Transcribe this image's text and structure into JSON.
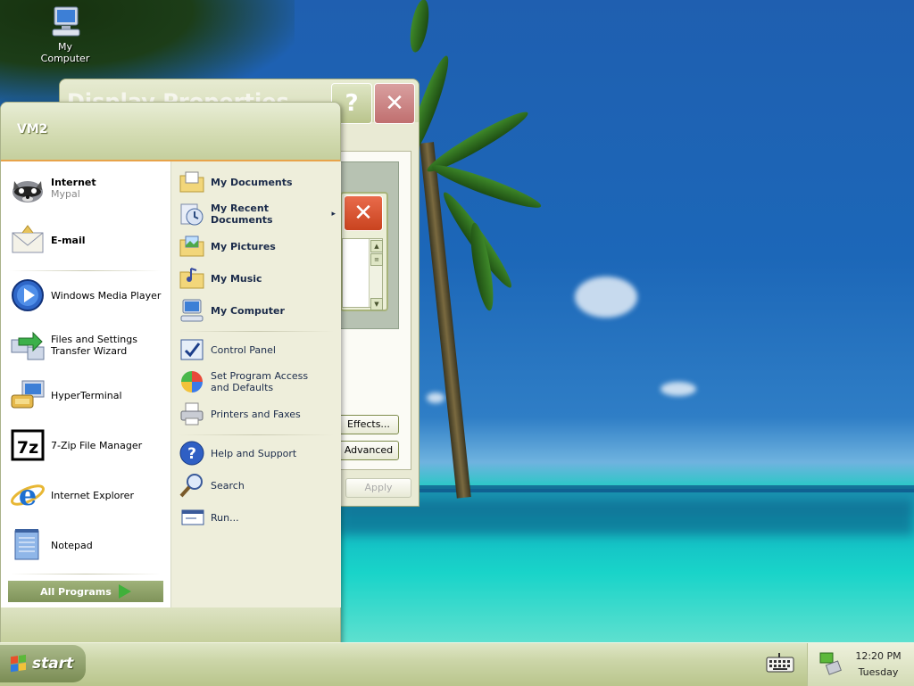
{
  "desktop": {
    "icons": [
      {
        "label": "My Computer",
        "icon": "my-computer-icon"
      }
    ]
  },
  "display_properties": {
    "title": "Display Properties",
    "help_label": "?",
    "close_label": "✕",
    "preview_close_label": "✕",
    "effects_label": "Effects...",
    "advanced_label": "Advanced",
    "apply_label": "Apply"
  },
  "start_menu": {
    "user_name": "VM2",
    "pinned": [
      {
        "title": "Internet",
        "subtitle": "Mypal",
        "icon": "raccoon-browser-icon"
      },
      {
        "title": "E-mail",
        "subtitle": "",
        "icon": "email-envelope-icon"
      }
    ],
    "recent": [
      {
        "label": "Windows Media Player",
        "icon": "media-player-icon"
      },
      {
        "label": "Files and Settings Transfer Wizard",
        "icon": "transfer-wizard-icon"
      },
      {
        "label": "HyperTerminal",
        "icon": "hyperterminal-icon"
      },
      {
        "label": "7-Zip File Manager",
        "icon": "7zip-icon"
      },
      {
        "label": "Internet Explorer",
        "icon": "internet-explorer-icon"
      },
      {
        "label": "Notepad",
        "icon": "notepad-icon"
      }
    ],
    "all_programs_label": "All Programs",
    "right_column": [
      {
        "label": "My Documents",
        "icon": "folder-documents-icon",
        "bold": true
      },
      {
        "label": "My Recent Documents",
        "icon": "recent-documents-icon",
        "bold": true,
        "submenu": true
      },
      {
        "label": "My Pictures",
        "icon": "folder-pictures-icon",
        "bold": true
      },
      {
        "label": "My Music",
        "icon": "folder-music-icon",
        "bold": true
      },
      {
        "label": "My Computer",
        "icon": "my-computer-icon",
        "bold": true
      },
      {
        "label": "Control Panel",
        "icon": "control-panel-icon",
        "bold": false
      },
      {
        "label": "Set Program Access and Defaults",
        "icon": "program-access-icon",
        "bold": false
      },
      {
        "label": "Printers and Faxes",
        "icon": "printer-icon",
        "bold": false
      },
      {
        "label": "Help and Support",
        "icon": "help-icon",
        "bold": false
      },
      {
        "label": "Search",
        "icon": "search-icon",
        "bold": false
      },
      {
        "label": "Run...",
        "icon": "run-icon",
        "bold": false
      }
    ],
    "submenu_arrow": "▸"
  },
  "taskbar": {
    "start_label": "start",
    "clock_time": "12:20 PM",
    "clock_day": "Tuesday"
  },
  "colors": {
    "start_menu_accent": "#e8a34a",
    "taskbar_olive": "#ccd6a8"
  }
}
